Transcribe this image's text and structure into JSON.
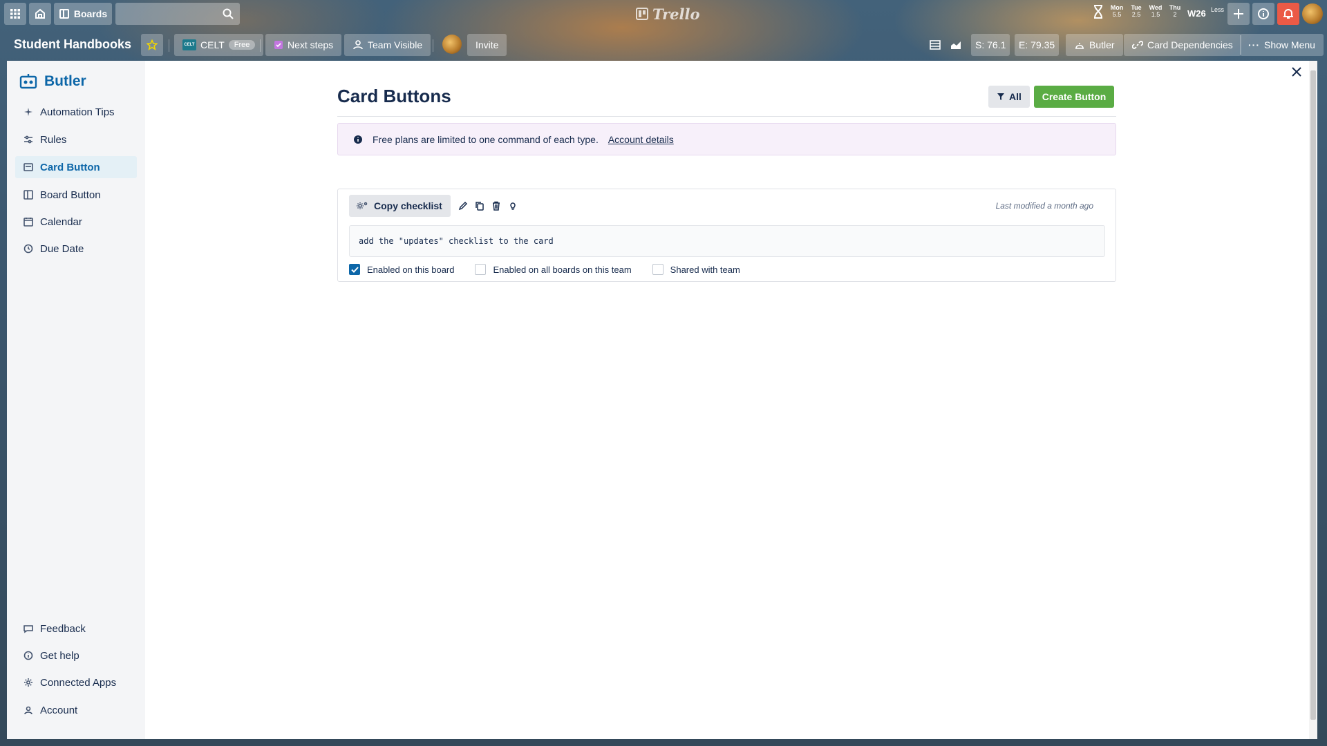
{
  "topbar": {
    "boards_label": "Boards",
    "logo_text": "Trello",
    "weekdays": [
      {
        "day": "Mon",
        "value": "5.5"
      },
      {
        "day": "Tue",
        "value": "2.5"
      },
      {
        "day": "Wed",
        "value": "1.5"
      },
      {
        "day": "Thu",
        "value": "2"
      }
    ],
    "week_label": "W26",
    "less_label": "Less"
  },
  "board": {
    "title": "Student Handbooks",
    "team_label": "CELT",
    "team_logo_text": "CELT",
    "free_badge": "Free",
    "next_steps_label": "Next steps",
    "visibility_label": "Team Visible",
    "invite_label": "Invite",
    "s_value": "S: 76.1",
    "e_value": "E: 79.35",
    "butler_label": "Butler",
    "card_dependencies_label": "Card Dependencies",
    "show_menu_label": "Show Menu"
  },
  "sidebar": {
    "title": "Butler",
    "items": [
      {
        "label": "Automation Tips",
        "icon": "sparkle-icon"
      },
      {
        "label": "Rules",
        "icon": "sliders-icon"
      },
      {
        "label": "Card Button",
        "icon": "card-icon",
        "active": true
      },
      {
        "label": "Board Button",
        "icon": "board-icon"
      },
      {
        "label": "Calendar",
        "icon": "calendar-icon"
      },
      {
        "label": "Due Date",
        "icon": "clock-icon"
      }
    ],
    "footer_items": [
      {
        "label": "Feedback",
        "icon": "chat-icon"
      },
      {
        "label": "Get help",
        "icon": "info-icon"
      },
      {
        "label": "Connected Apps",
        "icon": "gear-icon"
      },
      {
        "label": "Account",
        "icon": "person-icon"
      }
    ]
  },
  "main": {
    "title": "Card Buttons",
    "filter_label": "All",
    "create_button_label": "Create Button",
    "notice": {
      "text": "Free plans are limited to one command of each type.",
      "link": "Account details"
    },
    "command": {
      "name": "Copy checklist",
      "last_modified": "Last modified a month ago",
      "description": "add the \"updates\" checklist to the card",
      "options": [
        {
          "label": "Enabled on this board",
          "checked": true
        },
        {
          "label": "Enabled on all boards on this team",
          "checked": false
        },
        {
          "label": "Shared with team",
          "checked": false
        }
      ]
    }
  },
  "colors": {
    "accent_blue": "#0c66a8",
    "create_green": "#5aac44",
    "notification_red": "#eb5a46"
  }
}
